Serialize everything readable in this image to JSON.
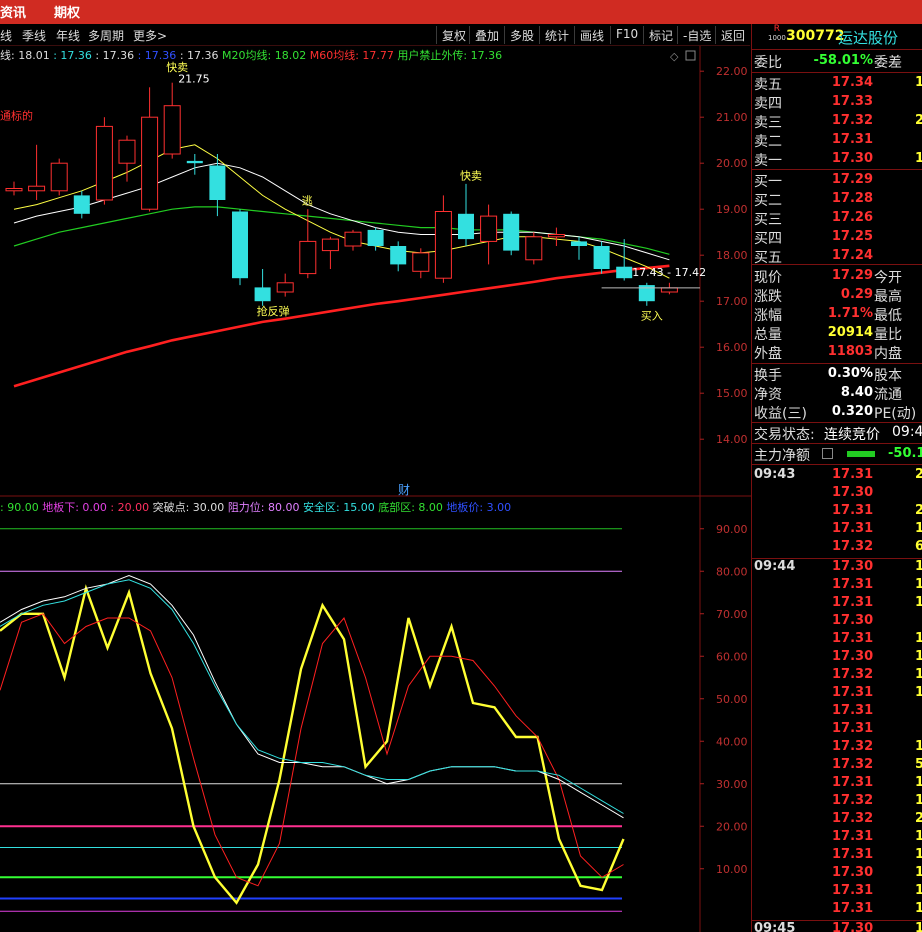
{
  "topbar": {
    "items": [
      "资讯",
      "期权"
    ]
  },
  "toolbar": {
    "periods": [
      "线",
      "季线",
      "年线",
      "多周期",
      "更多>"
    ],
    "buttons": [
      "复权",
      "叠加",
      "多股",
      "统计",
      "画线",
      "F10",
      "标记",
      "-自选",
      "返回"
    ]
  },
  "ma_legend": [
    {
      "text": "线: 18.01",
      "color": "#dddddd"
    },
    {
      "text": ": 17.36",
      "color": "#33e0e0"
    },
    {
      "text": ": 17.36",
      "color": "#dddddd"
    },
    {
      "text": ": 17.36",
      "color": "#3050ff"
    },
    {
      "text": ": 17.36",
      "color": "#dddddd"
    },
    {
      "text": "M20均线: 18.02",
      "color": "#33e033"
    },
    {
      "text": "M60均线: 17.77",
      "color": "#ff3030"
    },
    {
      "text": "用户禁止外传: 17.36",
      "color": "#33e033"
    }
  ],
  "indicator_legend": [
    {
      "text": ": 90.00",
      "color": "#33e033"
    },
    {
      "text": "地板下: 0.00",
      "color": "#e040e0"
    },
    {
      "text": ": 20.00",
      "color": "#ff3060"
    },
    {
      "text": "突破点: 30.00",
      "color": "#dddddd"
    },
    {
      "text": "阻力位: 80.00",
      "color": "#e080ff"
    },
    {
      "text": "安全区: 15.00",
      "color": "#33e0e0"
    },
    {
      "text": "底部区: 8.00",
      "color": "#33e033"
    },
    {
      "text": "地板价: 3.00",
      "color": "#3050ff"
    }
  ],
  "chart_data": [
    {
      "type": "candlestick",
      "y_axis_labels": [
        "22.00",
        "21.00",
        "20.00",
        "19.00",
        "18.00",
        "17.00",
        "16.00",
        "15.00",
        "14.00"
      ],
      "ylim": [
        13.2,
        22.2
      ],
      "x_count": 30,
      "candles": [
        {
          "o": 19.4,
          "c": 19.45,
          "h": 19.6,
          "l": 19.3
        },
        {
          "o": 19.4,
          "c": 19.5,
          "h": 20.4,
          "l": 19.2
        },
        {
          "o": 19.4,
          "c": 20.0,
          "h": 20.1,
          "l": 19.3
        },
        {
          "o": 19.3,
          "c": 18.9,
          "h": 19.4,
          "l": 18.8
        },
        {
          "o": 19.2,
          "c": 20.8,
          "h": 21.0,
          "l": 19.1
        },
        {
          "o": 20.0,
          "c": 20.5,
          "h": 20.6,
          "l": 19.6
        },
        {
          "o": 19.0,
          "c": 21.0,
          "h": 21.65,
          "l": 18.95
        },
        {
          "o": 20.2,
          "c": 21.25,
          "h": 21.75,
          "l": 20.1
        },
        {
          "o": 20.05,
          "c": 20.0,
          "h": 20.2,
          "l": 19.75
        },
        {
          "o": 19.95,
          "c": 19.2,
          "h": 20.2,
          "l": 18.85
        },
        {
          "o": 18.95,
          "c": 17.5,
          "h": 19.0,
          "l": 17.35
        },
        {
          "o": 17.3,
          "c": 17.0,
          "h": 17.7,
          "l": 16.9
        },
        {
          "o": 17.2,
          "c": 17.4,
          "h": 17.6,
          "l": 17.1
        },
        {
          "o": 17.6,
          "c": 18.3,
          "h": 19.0,
          "l": 17.5
        },
        {
          "o": 18.1,
          "c": 18.35,
          "h": 18.4,
          "l": 17.7
        },
        {
          "o": 18.2,
          "c": 18.5,
          "h": 18.55,
          "l": 18.1
        },
        {
          "o": 18.55,
          "c": 18.2,
          "h": 18.6,
          "l": 18.1
        },
        {
          "o": 18.2,
          "c": 17.8,
          "h": 18.3,
          "l": 17.65
        },
        {
          "o": 17.65,
          "c": 18.05,
          "h": 18.15,
          "l": 17.5
        },
        {
          "o": 17.5,
          "c": 18.95,
          "h": 19.3,
          "l": 17.4
        },
        {
          "o": 18.9,
          "c": 18.35,
          "h": 19.55,
          "l": 18.2
        },
        {
          "o": 18.3,
          "c": 18.85,
          "h": 19.1,
          "l": 17.8
        },
        {
          "o": 18.9,
          "c": 18.1,
          "h": 18.95,
          "l": 18.0
        },
        {
          "o": 17.9,
          "c": 18.4,
          "h": 18.5,
          "l": 17.8
        },
        {
          "o": 18.4,
          "c": 18.45,
          "h": 18.6,
          "l": 18.2
        },
        {
          "o": 18.3,
          "c": 18.2,
          "h": 18.4,
          "l": 17.9
        },
        {
          "o": 18.2,
          "c": 17.7,
          "h": 18.3,
          "l": 17.6
        },
        {
          "o": 17.75,
          "c": 17.5,
          "h": 18.35,
          "l": 17.45
        },
        {
          "o": 17.35,
          "c": 17.0,
          "h": 17.4,
          "l": 16.9
        },
        {
          "o": 17.2,
          "c": 17.29,
          "h": 17.4,
          "l": 17.15
        }
      ],
      "ma_yellow": [
        19.0,
        19.1,
        19.25,
        19.4,
        19.6,
        19.8,
        20.05,
        20.3,
        20.4,
        20.1,
        19.7,
        19.3,
        19.0,
        18.75,
        18.5,
        18.3,
        18.2,
        18.1,
        18.05,
        18.1,
        18.2,
        18.3,
        18.4,
        18.4,
        18.35,
        18.3,
        18.15,
        17.95,
        17.75,
        17.5
      ],
      "ma_white": [
        18.7,
        18.85,
        18.95,
        19.05,
        19.2,
        19.35,
        19.5,
        19.7,
        19.9,
        20.0,
        19.9,
        19.7,
        19.4,
        19.1,
        18.9,
        18.75,
        18.6,
        18.5,
        18.45,
        18.45,
        18.45,
        18.5,
        18.5,
        18.5,
        18.45,
        18.4,
        18.3,
        18.2,
        18.05,
        17.9
      ],
      "ma_green": [
        18.2,
        18.35,
        18.5,
        18.6,
        18.7,
        18.8,
        18.9,
        19.0,
        19.05,
        19.05,
        19.0,
        18.95,
        18.9,
        18.85,
        18.8,
        18.75,
        18.7,
        18.65,
        18.6,
        18.6,
        18.55,
        18.55,
        18.55,
        18.5,
        18.45,
        18.4,
        18.35,
        18.25,
        18.15,
        18.02
      ],
      "ma_red": [
        15.15,
        15.3,
        15.45,
        15.6,
        15.75,
        15.9,
        16.02,
        16.15,
        16.25,
        16.35,
        16.45,
        16.55,
        16.62,
        16.7,
        16.78,
        16.86,
        16.94,
        17.0,
        17.07,
        17.14,
        17.21,
        17.28,
        17.35,
        17.42,
        17.5,
        17.56,
        17.62,
        17.68,
        17.72,
        17.77
      ],
      "annotations": [
        {
          "i": 7,
          "price": 21.75,
          "text": "21.75"
        },
        {
          "i": 7,
          "price": 22.0,
          "text": "快卖"
        },
        {
          "i": 0,
          "price": 20.95,
          "text": "通标的"
        },
        {
          "i": 11,
          "price": 16.7,
          "text": "抢反弹"
        },
        {
          "i": 13,
          "price": 19.1,
          "text": "逃"
        },
        {
          "i": 20,
          "price": 19.65,
          "text": "快卖"
        },
        {
          "i": 28,
          "price": 16.6,
          "text": "买入"
        },
        {
          "i": 27,
          "price": 17.55,
          "text": "17.43 - 17.42"
        }
      ],
      "marker_text": "财"
    },
    {
      "type": "line",
      "y_axis_labels": [
        "90.00",
        "80.00",
        "70.00",
        "60.00",
        "50.00",
        "40.00",
        "30.00",
        "20.00",
        "10.00"
      ],
      "ylim": [
        -3,
        93
      ],
      "x_count": 30,
      "hlines": [
        {
          "value": 90,
          "color": "#22c022"
        },
        {
          "value": 80,
          "color": "#e080ff"
        },
        {
          "value": 30,
          "color": "#dddddd"
        },
        {
          "value": 20,
          "color": "#ff3090"
        },
        {
          "value": 15,
          "color": "#33e0e0"
        },
        {
          "value": 8,
          "color": "#33ff33"
        },
        {
          "value": 3,
          "color": "#2040ff"
        },
        {
          "value": 0,
          "color": "#e040e0"
        }
      ],
      "series": [
        {
          "color": "#ffff33",
          "values": [
            66,
            70,
            70,
            55,
            76,
            62,
            75,
            56,
            43,
            20,
            8,
            2,
            11,
            31,
            57,
            72,
            64,
            34,
            40,
            69,
            53,
            67,
            49,
            48,
            41,
            41,
            17,
            6,
            5,
            17
          ]
        },
        {
          "color": "#ff2020",
          "values": [
            52,
            68,
            70,
            63,
            67,
            69,
            69,
            66,
            55,
            36,
            18,
            8,
            6,
            16,
            43,
            63,
            69,
            55,
            37,
            53,
            60,
            60,
            59,
            53,
            46,
            41,
            31,
            13,
            8,
            11
          ]
        },
        {
          "color": "#ffffff",
          "values": [
            68,
            71,
            73,
            74,
            76,
            77,
            79,
            77,
            72,
            65,
            54,
            44,
            37,
            35,
            35,
            34,
            34,
            32,
            30,
            31,
            33,
            34,
            34,
            34,
            33,
            33,
            31,
            28,
            25,
            22
          ]
        },
        {
          "color": "#33e0e0",
          "values": [
            67,
            70,
            72,
            73,
            75,
            77,
            78,
            76,
            71,
            63,
            53,
            44,
            38,
            36,
            35,
            35,
            34,
            32,
            31,
            31,
            33,
            34,
            34,
            34,
            33,
            33,
            32,
            29,
            26,
            23
          ]
        }
      ]
    }
  ],
  "quote": {
    "code": "300772",
    "name": "运达股份",
    "badge_top": "R",
    "badge_bottom": "1000",
    "weibi": {
      "label": "委比",
      "value": "-58.01%",
      "extra": "委差"
    },
    "sells": [
      {
        "label": "卖五",
        "price": "17.34",
        "vol": "1"
      },
      {
        "label": "卖四",
        "price": "17.33",
        "vol": ""
      },
      {
        "label": "卖三",
        "price": "17.32",
        "vol": "2"
      },
      {
        "label": "卖二",
        "price": "17.31",
        "vol": ""
      },
      {
        "label": "卖一",
        "price": "17.30",
        "vol": "1"
      }
    ],
    "buys": [
      {
        "label": "买一",
        "price": "17.29",
        "vol": ""
      },
      {
        "label": "买二",
        "price": "17.28",
        "vol": ""
      },
      {
        "label": "买三",
        "price": "17.26",
        "vol": ""
      },
      {
        "label": "买四",
        "price": "17.25",
        "vol": ""
      },
      {
        "label": "买五",
        "price": "17.24",
        "vol": ""
      }
    ],
    "stats": [
      {
        "label": "现价",
        "value": "17.29",
        "color": "#ff3030",
        "extra": "今开"
      },
      {
        "label": "涨跌",
        "value": "0.29",
        "color": "#ff3030",
        "extra": "最高"
      },
      {
        "label": "涨幅",
        "value": "1.71%",
        "color": "#ff3030",
        "extra": "最低"
      },
      {
        "label": "总量",
        "value": "20914",
        "color": "#ffff33",
        "extra": "量比"
      },
      {
        "label": "外盘",
        "value": "11803",
        "color": "#ff3030",
        "extra": "内盘"
      }
    ],
    "stats2": [
      {
        "label": "换手",
        "value": "0.30%",
        "color": "#ffffff",
        "extra": "股本"
      },
      {
        "label": "净资",
        "value": "8.40",
        "color": "#ffffff",
        "extra": "流通"
      },
      {
        "label": "收益(三)",
        "value": "0.320",
        "color": "#ffffff",
        "extra": "PE(动)"
      }
    ],
    "trade_status_label": "交易状态:",
    "trade_status_value": "连续竞价",
    "trade_status_time": "09:4",
    "main_flow_label": "主力净额",
    "main_flow_value": "-50.1"
  },
  "ticks": [
    {
      "time": "09:43",
      "price": "17.31",
      "color": "#ff3030",
      "vol": "2"
    },
    {
      "time": "",
      "price": "17.30",
      "color": "#ff3030",
      "vol": ""
    },
    {
      "time": "",
      "price": "17.31",
      "color": "#ff3030",
      "vol": "2"
    },
    {
      "time": "",
      "price": "17.31",
      "color": "#ff3030",
      "vol": "1"
    },
    {
      "time": "",
      "price": "17.32",
      "color": "#ff3030",
      "vol": "6"
    },
    {
      "time": "09:44",
      "price": "17.30",
      "color": "#ff3030",
      "vol": "17"
    },
    {
      "time": "",
      "price": "17.31",
      "color": "#ff3030",
      "vol": "16"
    },
    {
      "time": "",
      "price": "17.31",
      "color": "#ff3030",
      "vol": "1"
    },
    {
      "time": "",
      "price": "17.30",
      "color": "#ff3030",
      "vol": ""
    },
    {
      "time": "",
      "price": "17.31",
      "color": "#ff3030",
      "vol": "1"
    },
    {
      "time": "",
      "price": "17.30",
      "color": "#ff3030",
      "vol": "1"
    },
    {
      "time": "",
      "price": "17.32",
      "color": "#ff3030",
      "vol": "1"
    },
    {
      "time": "",
      "price": "17.31",
      "color": "#ff3030",
      "vol": "1"
    },
    {
      "time": "",
      "price": "17.31",
      "color": "#ff3030",
      "vol": ""
    },
    {
      "time": "",
      "price": "17.31",
      "color": "#ff3030",
      "vol": ""
    },
    {
      "time": "",
      "price": "17.32",
      "color": "#ff3030",
      "vol": "1"
    },
    {
      "time": "",
      "price": "17.32",
      "color": "#ff3030",
      "vol": "5"
    },
    {
      "time": "",
      "price": "17.31",
      "color": "#ff3030",
      "vol": "1"
    },
    {
      "time": "",
      "price": "17.32",
      "color": "#ff3030",
      "vol": "1"
    },
    {
      "time": "",
      "price": "17.32",
      "color": "#ff3030",
      "vol": "2"
    },
    {
      "time": "",
      "price": "17.31",
      "color": "#ff3030",
      "vol": "1"
    },
    {
      "time": "",
      "price": "17.31",
      "color": "#ff3030",
      "vol": "1"
    },
    {
      "time": "",
      "price": "17.30",
      "color": "#ff3030",
      "vol": "1"
    },
    {
      "time": "",
      "price": "17.31",
      "color": "#ff3030",
      "vol": "1"
    },
    {
      "time": "",
      "price": "17.31",
      "color": "#ff3030",
      "vol": "1"
    },
    {
      "time": "09:45",
      "price": "17.30",
      "color": "#ff3030",
      "vol": "1"
    }
  ],
  "colors": {
    "up": "#ff3030",
    "down": "#33e0e0",
    "accent": "#d02b22"
  }
}
